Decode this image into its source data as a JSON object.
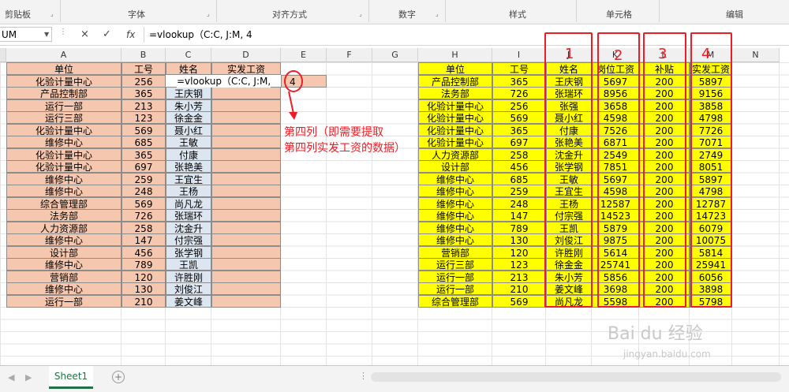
{
  "ribbon": {
    "groups": [
      "剪贴板",
      "字体",
      "对齐方式",
      "数字",
      "样式",
      "单元格",
      "编辑"
    ]
  },
  "formula_bar": {
    "name_box": "UM",
    "cancel_icon": "×",
    "enter_icon": "✓",
    "fx_label": "fx",
    "formula": "=vlookup（C:C,  J:M,  4"
  },
  "columns": [
    "A",
    "B",
    "C",
    "D",
    "E",
    "F",
    "G",
    "H",
    "I",
    "J",
    "K",
    "L",
    "M",
    "N"
  ],
  "left_table": {
    "headers": [
      "单位",
      "工号",
      "姓名",
      "实发工资"
    ],
    "rows": [
      [
        "化验计量中心",
        "256",
        "",
        ""
      ],
      [
        "产品控制部",
        "365",
        "王庆钢",
        ""
      ],
      [
        "运行一部",
        "213",
        "朱小芳",
        ""
      ],
      [
        "运行三部",
        "123",
        "徐金金",
        ""
      ],
      [
        "化验计量中心",
        "569",
        "聂小红",
        ""
      ],
      [
        "维修中心",
        "685",
        "王敏",
        ""
      ],
      [
        "化验计量中心",
        "365",
        "付康",
        ""
      ],
      [
        "化验计量中心",
        "697",
        "张艳美",
        ""
      ],
      [
        "维修中心",
        "259",
        "王宜生",
        ""
      ],
      [
        "维修中心",
        "248",
        "王杨",
        ""
      ],
      [
        "综合管理部",
        "569",
        "尚凡龙",
        ""
      ],
      [
        "法务部",
        "726",
        "张瑞环",
        ""
      ],
      [
        "人力资源部",
        "258",
        "沈金升",
        ""
      ],
      [
        "维修中心",
        "147",
        "付宗强",
        ""
      ],
      [
        "设计部",
        "456",
        "张学钢",
        ""
      ],
      [
        "维修中心",
        "789",
        "王凯",
        ""
      ],
      [
        "营销部",
        "120",
        "许胜刚",
        ""
      ],
      [
        "维修中心",
        "130",
        "刘俊江",
        ""
      ],
      [
        "运行一部",
        "210",
        "姜文峰",
        ""
      ]
    ],
    "editing_formula": "=vlookup（C:C,  J:M,",
    "e2_value": "4"
  },
  "right_table": {
    "headers": [
      "单位",
      "工号",
      "姓名",
      "岗位工资",
      "补贴",
      "实发工资"
    ],
    "rows": [
      [
        "产品控制部",
        "365",
        "王庆钢",
        "5697",
        "200",
        "5897"
      ],
      [
        "法务部",
        "726",
        "张瑞环",
        "8956",
        "200",
        "9156"
      ],
      [
        "化验计量中心",
        "256",
        "张强",
        "3658",
        "200",
        "3858"
      ],
      [
        "化验计量中心",
        "569",
        "聂小红",
        "4598",
        "200",
        "4798"
      ],
      [
        "化验计量中心",
        "365",
        "付康",
        "7526",
        "200",
        "7726"
      ],
      [
        "化验计量中心",
        "697",
        "张艳美",
        "6871",
        "200",
        "7071"
      ],
      [
        "人力资源部",
        "258",
        "沈金升",
        "2549",
        "200",
        "2749"
      ],
      [
        "设计部",
        "456",
        "张学钢",
        "7851",
        "200",
        "8051"
      ],
      [
        "维修中心",
        "685",
        "王敏",
        "5697",
        "200",
        "5897"
      ],
      [
        "维修中心",
        "259",
        "王宜生",
        "4598",
        "200",
        "4798"
      ],
      [
        "维修中心",
        "248",
        "王杨",
        "12587",
        "200",
        "12787"
      ],
      [
        "维修中心",
        "147",
        "付宗强",
        "14523",
        "200",
        "14723"
      ],
      [
        "维修中心",
        "789",
        "王凯",
        "5879",
        "200",
        "6079"
      ],
      [
        "维修中心",
        "130",
        "刘俊江",
        "9875",
        "200",
        "10075"
      ],
      [
        "营销部",
        "120",
        "许胜刚",
        "5614",
        "200",
        "5814"
      ],
      [
        "运行三部",
        "123",
        "徐金金",
        "25741",
        "200",
        "25941"
      ],
      [
        "运行一部",
        "213",
        "朱小芳",
        "5856",
        "200",
        "6056"
      ],
      [
        "运行一部",
        "210",
        "姜文峰",
        "3698",
        "200",
        "3898"
      ],
      [
        "综合管理部",
        "569",
        "尚凡龙",
        "5598",
        "200",
        "5798"
      ]
    ]
  },
  "annotations": {
    "column_numbers": [
      "1",
      "2",
      "3",
      "4"
    ],
    "note_line1": "第四列（即需要提取",
    "note_line2": "第四列实发工资的数据）",
    "accent_color": "#ee1c24"
  },
  "sheet_tabs": {
    "active": "Sheet1",
    "add_icon": "+"
  },
  "watermark": {
    "line1": "Bai du 经验",
    "line2": "jingyan.baidu.com"
  },
  "colors": {
    "left_fill": "#f5c7ae",
    "right_fill": "#ffff00",
    "sheet_tab_accent": "#217346"
  }
}
